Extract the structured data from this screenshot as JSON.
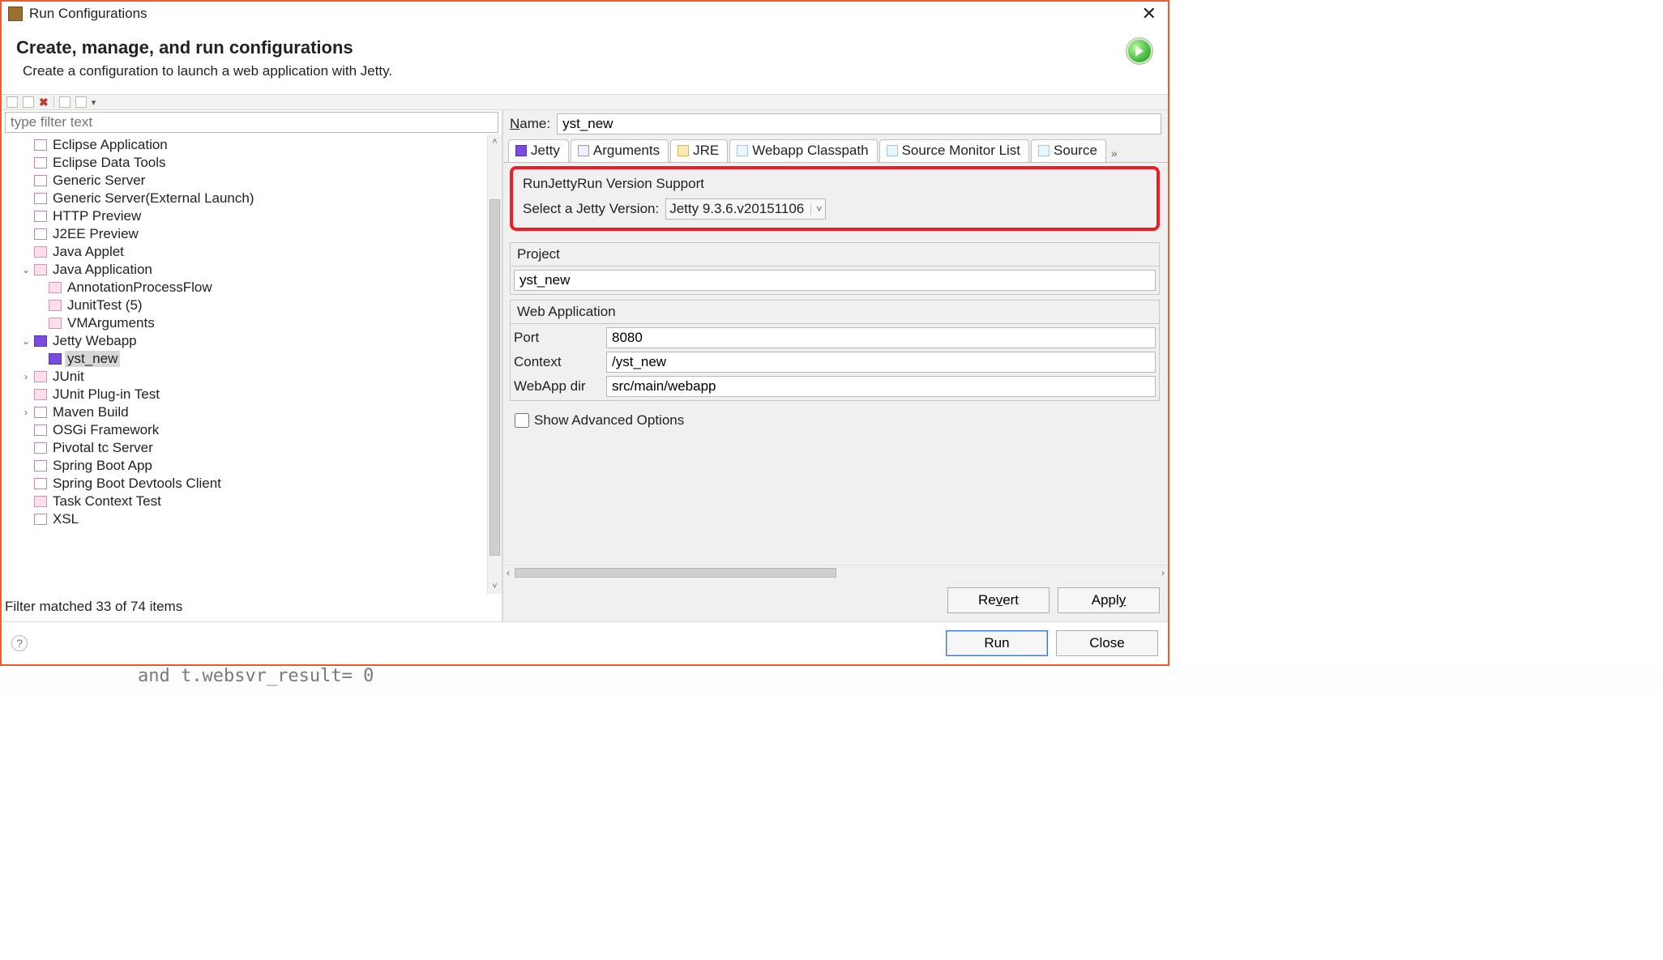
{
  "titlebar": {
    "title": "Run Configurations"
  },
  "header": {
    "heading": "Create, manage, and run configurations",
    "sub": "Create a configuration to launch a web application with Jetty."
  },
  "filter": {
    "placeholder": "type filter text"
  },
  "tree": {
    "items": [
      {
        "label": "Eclipse Application",
        "indent": 1,
        "icon": "i-folder"
      },
      {
        "label": "Eclipse Data Tools",
        "indent": 1,
        "icon": "i-folder"
      },
      {
        "label": "Generic Server",
        "indent": 1,
        "icon": "i-folder"
      },
      {
        "label": "Generic Server(External Launch)",
        "indent": 1,
        "icon": "i-folder"
      },
      {
        "label": "HTTP Preview",
        "indent": 1,
        "icon": "i-folder"
      },
      {
        "label": "J2EE Preview",
        "indent": 1,
        "icon": "i-folder"
      },
      {
        "label": "Java Applet",
        "indent": 1,
        "icon": "i-j"
      },
      {
        "label": "Java Application",
        "indent": 1,
        "icon": "i-j",
        "twisty": "v"
      },
      {
        "label": "AnnotationProcessFlow",
        "indent": 2,
        "icon": "i-j"
      },
      {
        "label": "JunitTest (5)",
        "indent": 2,
        "icon": "i-j"
      },
      {
        "label": "VMArguments",
        "indent": 2,
        "icon": "i-j"
      },
      {
        "label": "Jetty Webapp",
        "indent": 1,
        "icon": "i-jetty",
        "twisty": "v"
      },
      {
        "label": "yst_new",
        "indent": 2,
        "icon": "i-jetty",
        "selected": true
      },
      {
        "label": "JUnit",
        "indent": 1,
        "icon": "i-j",
        "twisty": ">"
      },
      {
        "label": "JUnit Plug-in Test",
        "indent": 1,
        "icon": "i-j"
      },
      {
        "label": "Maven Build",
        "indent": 1,
        "icon": "i-folder",
        "twisty": ">"
      },
      {
        "label": "OSGi Framework",
        "indent": 1,
        "icon": "i-folder"
      },
      {
        "label": "Pivotal tc Server",
        "indent": 1,
        "icon": "i-folder"
      },
      {
        "label": "Spring Boot App",
        "indent": 1,
        "icon": "i-folder"
      },
      {
        "label": "Spring Boot Devtools Client",
        "indent": 1,
        "icon": "i-folder"
      },
      {
        "label": "Task Context Test",
        "indent": 1,
        "icon": "i-j"
      },
      {
        "label": "XSL",
        "indent": 1,
        "icon": "i-folder"
      }
    ],
    "status": "Filter matched 33 of 74 items"
  },
  "form": {
    "name_label": "Name:",
    "name_value": "yst_new",
    "tabs": [
      "Jetty",
      "Arguments",
      "JRE",
      "Webapp Classpath",
      "Source Monitor List",
      "Source"
    ],
    "version_group_title": "RunJettyRun Version Support",
    "version_label": "Select a Jetty Version:",
    "version_value": "Jetty 9.3.6.v20151106",
    "project_title": "Project",
    "project_value": "yst_new",
    "webapp_title": "Web Application",
    "port_label": "Port",
    "port_value": "8080",
    "context_label": "Context",
    "context_value": "/yst_new",
    "webappdir_label": "WebApp dir",
    "webappdir_value": "src/main/webapp",
    "adv_label": "Show Advanced Options"
  },
  "buttons": {
    "revert": "Revert",
    "apply": "Apply",
    "run": "Run",
    "close": "Close"
  },
  "outside": "and  t.websvr_result=  0"
}
